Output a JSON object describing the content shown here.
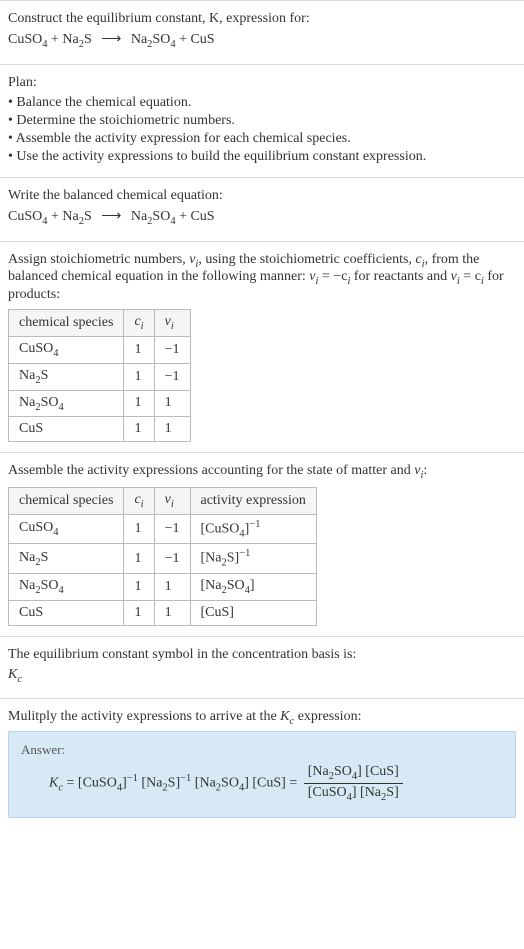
{
  "intro": {
    "line1": "Construct the equilibrium constant, K, expression for:",
    "eq_lhs1": "CuSO",
    "eq_lhs1_sub": "4",
    "eq_plus1": " + Na",
    "eq_lhs2_sub": "2",
    "eq_lhs2_tail": "S",
    "eq_arrow": "⟶",
    "eq_rhs1": " Na",
    "eq_rhs1_sub": "2",
    "eq_rhs1_mid": "SO",
    "eq_rhs1_sub2": "4",
    "eq_plus2": " + CuS"
  },
  "plan": {
    "title": "Plan:",
    "items": [
      "• Balance the chemical equation.",
      "• Determine the stoichiometric numbers.",
      "• Assemble the activity expression for each chemical species.",
      "• Use the activity expressions to build the equilibrium constant expression."
    ]
  },
  "balanced": {
    "title": "Write the balanced chemical equation:"
  },
  "assign": {
    "line1a": "Assign stoichiometric numbers, ",
    "nu": "ν",
    "nu_sub": "i",
    "line1b": ", using the stoichiometric coefficients, ",
    "c": "c",
    "c_sub": "i",
    "line1c": ", from the balanced chemical equation in the following manner: ",
    "rel1a": "ν",
    "rel1b": "i",
    "rel1c": " = −c",
    "rel1d": "i",
    "line1d": " for reactants and ",
    "rel2a": "ν",
    "rel2b": "i",
    "rel2c": " = c",
    "rel2d": "i",
    "line1e": " for products:",
    "headers": [
      "chemical species",
      "c",
      "ν"
    ],
    "header_sub": "i",
    "rows": [
      {
        "sp_a": "CuSO",
        "sp_sub": "4",
        "sp_b": "",
        "c": "1",
        "nu": "−1"
      },
      {
        "sp_a": "Na",
        "sp_sub": "2",
        "sp_b": "S",
        "c": "1",
        "nu": "−1"
      },
      {
        "sp_a": "Na",
        "sp_sub": "2",
        "sp_b": "SO",
        "sp_sub2": "4",
        "c": "1",
        "nu": "1"
      },
      {
        "sp_a": "CuS",
        "sp_sub": "",
        "sp_b": "",
        "c": "1",
        "nu": "1"
      }
    ]
  },
  "activity": {
    "title_a": "Assemble the activity expressions accounting for the state of matter and ",
    "title_nu": "ν",
    "title_nu_sub": "i",
    "title_b": ":",
    "headers": [
      "chemical species",
      "c",
      "ν",
      "activity expression"
    ],
    "header_sub": "i",
    "rows": [
      {
        "sp_a": "CuSO",
        "sp_sub": "4",
        "sp_b": "",
        "c": "1",
        "nu": "−1",
        "act_a": "[CuSO",
        "act_sub": "4",
        "act_b": "]",
        "act_sup": "−1"
      },
      {
        "sp_a": "Na",
        "sp_sub": "2",
        "sp_b": "S",
        "c": "1",
        "nu": "−1",
        "act_a": "[Na",
        "act_sub": "2",
        "act_b": "S]",
        "act_sup": "−1"
      },
      {
        "sp_a": "Na",
        "sp_sub": "2",
        "sp_b": "SO",
        "sp_sub2": "4",
        "c": "1",
        "nu": "1",
        "act_a": "[Na",
        "act_sub": "2",
        "act_b": "SO",
        "act_sub2": "4",
        "act_c": "]",
        "act_sup": ""
      },
      {
        "sp_a": "CuS",
        "sp_sub": "",
        "sp_b": "",
        "c": "1",
        "nu": "1",
        "act_a": "[CuS]",
        "act_sub": "",
        "act_b": "",
        "act_sup": ""
      }
    ]
  },
  "symbol": {
    "line": "The equilibrium constant symbol in the concentration basis is:",
    "K": "K",
    "K_sub": "c"
  },
  "multiply": {
    "line_a": "Mulitply the activity expressions to arrive at the ",
    "K": "K",
    "K_sub": "c",
    "line_b": " expression:"
  },
  "answer": {
    "label": "Answer:",
    "K": "K",
    "K_sub": "c",
    "eq": " = ",
    "t1_a": "[CuSO",
    "t1_sub": "4",
    "t1_b": "]",
    "t1_sup": "−1",
    "t2_a": " [Na",
    "t2_sub": "2",
    "t2_b": "S]",
    "t2_sup": "−1",
    "t3_a": " [Na",
    "t3_sub": "2",
    "t3_mid": "SO",
    "t3_sub2": "4",
    "t3_b": "]",
    "t4": " [CuS] = ",
    "num_a": "[Na",
    "num_sub": "2",
    "num_mid": "SO",
    "num_sub2": "4",
    "num_b": "] [CuS]",
    "den_a": "[CuSO",
    "den_sub": "4",
    "den_mid": "] [Na",
    "den_sub2": "2",
    "den_b": "S]"
  }
}
